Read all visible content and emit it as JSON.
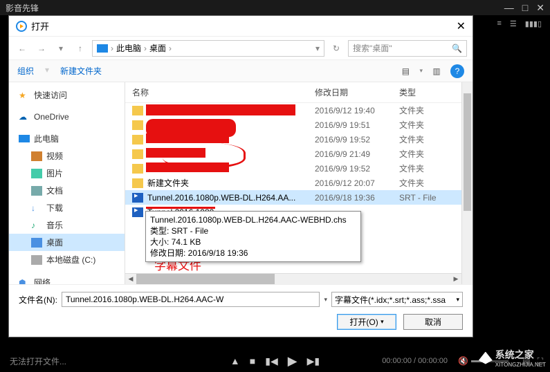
{
  "app": {
    "title": "影音先锋",
    "status": "无法打开文件..."
  },
  "dialog": {
    "title": "打开",
    "breadcrumb": {
      "pc": "此电脑",
      "desktop": "桌面"
    },
    "search_placeholder": "搜索\"桌面\"",
    "toolbar": {
      "organize": "组织",
      "newfolder": "新建文件夹"
    },
    "columns": {
      "name": "名称",
      "date": "修改日期",
      "type": "类型"
    },
    "filename_label": "文件名(N):",
    "filename_value": "Tunnel.2016.1080p.WEB-DL.H264.AAC-W",
    "filter": "字幕文件(*.idx;*.srt;*.ass;*.ssa",
    "open_btn": "打开(O)",
    "cancel_btn": "取消"
  },
  "sidebar": {
    "quick": "快速访问",
    "onedrive": "OneDrive",
    "pc": "此电脑",
    "video": "视频",
    "pictures": "图片",
    "documents": "文档",
    "downloads": "下载",
    "music": "音乐",
    "desktop": "桌面",
    "localdisk": "本地磁盘 (C:)",
    "network": "网络"
  },
  "files": [
    {
      "date": "2016/9/12 19:40",
      "type": "文件夹"
    },
    {
      "date": "2016/9/9 19:51",
      "type": "文件夹"
    },
    {
      "date": "2016/9/9 19:52",
      "type": "文件夹"
    },
    {
      "date": "2016/9/9 21:49",
      "type": "文件夹"
    },
    {
      "date": "2016/9/9 19:52",
      "type": "文件夹"
    },
    {
      "name": "新建文件夹",
      "date": "2016/9/12 20:07",
      "type": "文件夹"
    },
    {
      "name": "Tunnel.2016.1080p.WEB-DL.H264.AA...",
      "date": "2016/9/18 19:36",
      "type": "SRT - File",
      "selected": true
    },
    {
      "name": "Tunnel.2016.1080",
      "date": "",
      "type": ""
    }
  ],
  "tooltip": {
    "full": "Tunnel.2016.1080p.WEB-DL.H264.AAC-WEBHD.chs",
    "type_label": "类型: SRT - File",
    "size_label": "大小: 74.1 KB",
    "date_label": "修改日期: 2016/9/18 19:36"
  },
  "annotation": {
    "arrow": "↓",
    "label": "字幕文件"
  },
  "player": {
    "time": "00:00:00 / 00:00:00"
  },
  "watermark": {
    "name": "系统之家",
    "url": "XITONGZHIJIA.NET"
  }
}
